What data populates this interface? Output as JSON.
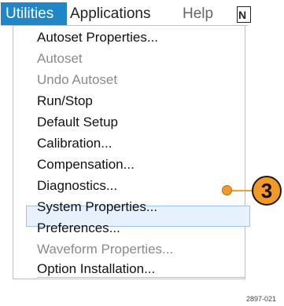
{
  "menubar": {
    "items": [
      {
        "label": "Utilities"
      },
      {
        "label": "Applications"
      },
      {
        "label": "Help"
      },
      {
        "label": "N"
      }
    ]
  },
  "menu": {
    "items": [
      {
        "label": "Autoset Properties...",
        "enabled": true
      },
      {
        "label": "Autoset",
        "enabled": false
      },
      {
        "label": "Undo Autoset",
        "enabled": false
      },
      {
        "label": "Run/Stop",
        "enabled": true
      },
      {
        "label": "Default Setup",
        "enabled": true
      },
      {
        "label": "Calibration...",
        "enabled": true
      },
      {
        "label": "Compensation...",
        "enabled": true
      },
      {
        "label": "Diagnostics...",
        "enabled": true,
        "highlighted": true
      },
      {
        "label": "System Properties...",
        "enabled": true
      },
      {
        "label": "Preferences...",
        "enabled": true
      },
      {
        "label": "Waveform Properties...",
        "enabled": false
      },
      {
        "label": "Option Installation...",
        "enabled": true
      }
    ]
  },
  "callout": {
    "number": "3",
    "color": "#f29a25"
  },
  "figure_code": "2897-021"
}
